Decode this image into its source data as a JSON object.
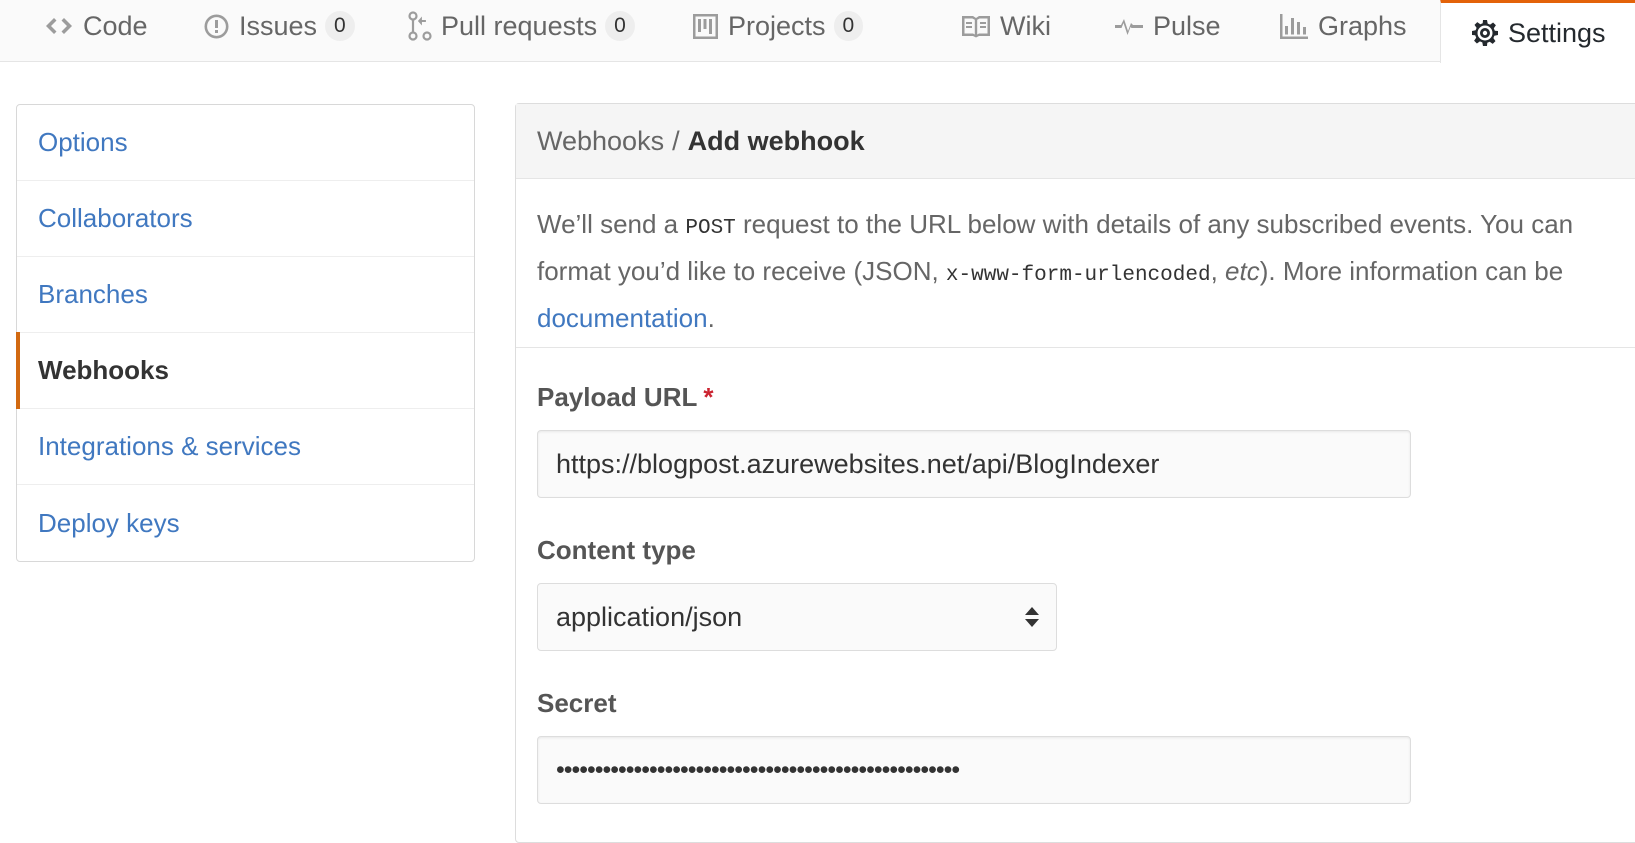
{
  "nav": {
    "tabs": [
      {
        "label": "Code",
        "icon": "code-icon"
      },
      {
        "label": "Issues",
        "icon": "issue-opened-icon",
        "count": "0"
      },
      {
        "label": "Pull requests",
        "icon": "git-pull-request-icon",
        "count": "0"
      },
      {
        "label": "Projects",
        "icon": "project-icon",
        "count": "0"
      },
      {
        "label": "Wiki",
        "icon": "book-icon"
      },
      {
        "label": "Pulse",
        "icon": "pulse-icon"
      },
      {
        "label": "Graphs",
        "icon": "graph-icon"
      },
      {
        "label": "Settings",
        "icon": "gear-icon",
        "selected": true
      }
    ]
  },
  "menu": {
    "items": [
      {
        "label": "Options"
      },
      {
        "label": "Collaborators"
      },
      {
        "label": "Branches"
      },
      {
        "label": "Webhooks",
        "selected": true
      },
      {
        "label": "Integrations & services"
      },
      {
        "label": "Deploy keys"
      }
    ]
  },
  "panel": {
    "breadcrumb_parent": "Webhooks",
    "breadcrumb_separator": "/",
    "breadcrumb_current": "Add webhook",
    "intro": {
      "line1_a": "We’ll send a ",
      "line1_code": "POST",
      "line1_b": " request to the URL below with details of any subscribed events. You can",
      "line2_a": "format you’d like to receive (JSON, ",
      "line2_code": "x-www-form-urlencoded",
      "line2_b": ", ",
      "line2_em": "etc",
      "line2_c": "). More information can be",
      "link": "documentation",
      "link_suffix": "."
    },
    "payload_url": {
      "label": "Payload URL",
      "required_mark": "*",
      "value": "https://blogpost.azurewebsites.net/api/BlogIndexer"
    },
    "content_type": {
      "label": "Content type",
      "value": "application/json"
    },
    "secret": {
      "label": "Secret",
      "value": "••••••••••••••••••••••••••••••••••••••••••••••••••••"
    }
  },
  "colors": {
    "link": "#4078c0",
    "selected_accent": "#e36209",
    "menu_accent": "#d26911",
    "required": "#cb2431"
  }
}
